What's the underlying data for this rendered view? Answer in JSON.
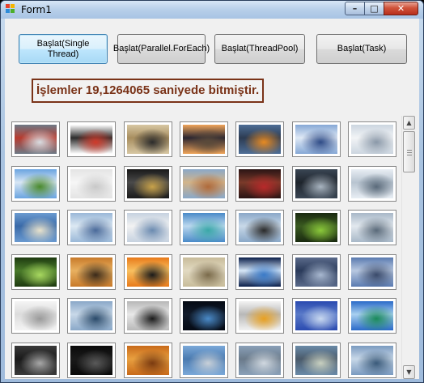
{
  "window": {
    "title": "Form1"
  },
  "buttons": {
    "single": "Başlat(Single Thread)",
    "parallel": "Başlat(Parallel.ForEach)",
    "threadpool": "Başlat(ThreadPool)",
    "task": "Başlat(Task)"
  },
  "result": "İşlemler 19,1264065 saniyede bitmiştir.",
  "thumbnail_columns": 7,
  "thumbnails": [
    {
      "name": "photo-1",
      "colors": [
        "#6e7a86",
        "#d8dde2",
        "#b73b2f"
      ]
    },
    {
      "name": "photo-2",
      "colors": [
        "#ffffff",
        "#d03a2a",
        "#2d2d2d"
      ]
    },
    {
      "name": "photo-3",
      "colors": [
        "#d7c7a3",
        "#2b2b2b",
        "#a88e5f"
      ]
    },
    {
      "name": "photo-4",
      "colors": [
        "#f0a55a",
        "#5a4a3a",
        "#2a2530"
      ]
    },
    {
      "name": "photo-5",
      "colors": [
        "#4e6e96",
        "#e78a22",
        "#2c3b52"
      ]
    },
    {
      "name": "photo-6",
      "colors": [
        "#86a8d6",
        "#2e4b87",
        "#dfe9f5"
      ]
    },
    {
      "name": "photo-7",
      "colors": [
        "#ccd6e0",
        "#8a98a8",
        "#f2f4f6"
      ]
    },
    {
      "name": "photo-8",
      "colors": [
        "#6aa4e0",
        "#4a8a2c",
        "#d8e6f4"
      ]
    },
    {
      "name": "photo-9",
      "colors": [
        "#e4e4e4",
        "#c8c8c8",
        "#f6f6f6"
      ]
    },
    {
      "name": "photo-10",
      "colors": [
        "#1a1a1a",
        "#c8a24a",
        "#4a4a4a"
      ]
    },
    {
      "name": "photo-11",
      "colors": [
        "#8aa8c8",
        "#b06a3a",
        "#d2b48a"
      ]
    },
    {
      "name": "photo-12",
      "colors": [
        "#2a1414",
        "#b82a2a",
        "#7a3a2a"
      ]
    },
    {
      "name": "photo-13",
      "colors": [
        "#3a4654",
        "#a8b4c0",
        "#1e242c"
      ]
    },
    {
      "name": "photo-14",
      "colors": [
        "#e8eef4",
        "#5a6a7a",
        "#b8c4d0"
      ]
    },
    {
      "name": "photo-15",
      "colors": [
        "#6a9ad0",
        "#e8e2cc",
        "#3a6aa8"
      ]
    },
    {
      "name": "photo-16",
      "colors": [
        "#9ab8d8",
        "#4a6a9a",
        "#dce8f2"
      ]
    },
    {
      "name": "photo-17",
      "colors": [
        "#c6d2e0",
        "#6a8ab0",
        "#f2f2f2"
      ]
    },
    {
      "name": "photo-18",
      "colors": [
        "#4a8ac8",
        "#3aa8a8",
        "#bcd8ee"
      ]
    },
    {
      "name": "photo-19",
      "colors": [
        "#8aa8c8",
        "#2a2a2a",
        "#c8d8e8"
      ]
    },
    {
      "name": "photo-20",
      "colors": [
        "#1a2a10",
        "#8ac83a",
        "#3a5a20"
      ]
    },
    {
      "name": "photo-21",
      "colors": [
        "#a8b8c8",
        "#5a6a7a",
        "#e2e8ee"
      ]
    },
    {
      "name": "photo-22",
      "colors": [
        "#1e3a10",
        "#a8d860",
        "#4a7a2a"
      ]
    },
    {
      "name": "photo-23",
      "colors": [
        "#c87a2a",
        "#3a2a1a",
        "#e8b060"
      ]
    },
    {
      "name": "photo-24",
      "colors": [
        "#e87a1a",
        "#1a1a1a",
        "#f8c060"
      ]
    },
    {
      "name": "photo-25",
      "colors": [
        "#c8bc9a",
        "#7a6a4a",
        "#e2dac2"
      ]
    },
    {
      "name": "photo-26",
      "colors": [
        "#0a1e4a",
        "#3a7ac8",
        "#d8e8f8"
      ]
    },
    {
      "name": "photo-27",
      "colors": [
        "#5a6a8a",
        "#a8b8d0",
        "#2a3a5a"
      ]
    },
    {
      "name": "photo-28",
      "colors": [
        "#5a7ab0",
        "#3a4a6a",
        "#b8c8e0"
      ]
    },
    {
      "name": "photo-29",
      "colors": [
        "#f4f4f4",
        "#9a9a9a",
        "#dcdcdc"
      ]
    },
    {
      "name": "photo-30",
      "colors": [
        "#8aa8c8",
        "#2a4a6a",
        "#c8d8e8"
      ]
    },
    {
      "name": "photo-31",
      "colors": [
        "#b8b8b8",
        "#1a1a1a",
        "#e8e8e8"
      ]
    },
    {
      "name": "photo-32",
      "colors": [
        "#050a14",
        "#4a8ac8",
        "#101a2a"
      ]
    },
    {
      "name": "photo-33",
      "colors": [
        "#f2f2f2",
        "#e8a020",
        "#b8b8b8"
      ]
    },
    {
      "name": "photo-34",
      "colors": [
        "#2a4ab0",
        "#c8d8f0",
        "#5a7ac8"
      ]
    },
    {
      "name": "photo-35",
      "colors": [
        "#2a6ac8",
        "#1a8a5a",
        "#a8d0f0"
      ]
    },
    {
      "name": "photo-36",
      "colors": [
        "#3a3a3a",
        "#a8a8a8",
        "#1a1a1a"
      ]
    },
    {
      "name": "photo-37",
      "colors": [
        "#0a0a0a",
        "#5a5a5a",
        "#1a1a1a"
      ]
    },
    {
      "name": "photo-38",
      "colors": [
        "#c86a1a",
        "#7a3a10",
        "#e8a040"
      ]
    },
    {
      "name": "photo-39",
      "colors": [
        "#7aa8d8",
        "#c8d0d8",
        "#4a7ab0"
      ]
    },
    {
      "name": "photo-40",
      "colors": [
        "#8aa0b8",
        "#d0d8e0",
        "#6a7a8a"
      ]
    },
    {
      "name": "photo-41",
      "colors": [
        "#6a8aa8",
        "#c8d0c0",
        "#4a5a6a"
      ]
    },
    {
      "name": "photo-42",
      "colors": [
        "#7a9ac0",
        "#3a5a7a",
        "#c8d8e8"
      ]
    }
  ]
}
